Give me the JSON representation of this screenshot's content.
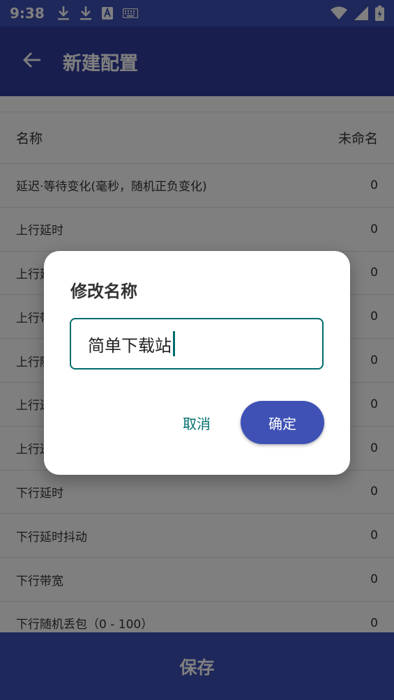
{
  "status_bar": {
    "time": "9:38",
    "left_icons": [
      "download-icon",
      "download-icon",
      "text-a-icon",
      "keyboard-icon"
    ],
    "right_icons": [
      "wifi-icon",
      "signal-icon",
      "battery-icon"
    ]
  },
  "app_bar": {
    "title": "新建配置",
    "back_icon": "arrow-back-icon"
  },
  "list": {
    "rows": [
      {
        "label": "名称",
        "value": "未命名"
      },
      {
        "label": "延迟·等待变化(毫秒，随机正负变化)",
        "value": "0"
      },
      {
        "label": "上行延时",
        "value": "0"
      },
      {
        "label": "上行延",
        "value": "0"
      },
      {
        "label": "上行带",
        "value": "0"
      },
      {
        "label": "上行随",
        "value": "0"
      },
      {
        "label": "上行送",
        "value": "0"
      },
      {
        "label": "上行送",
        "value": "0"
      },
      {
        "label": "下行延时",
        "value": "0"
      },
      {
        "label": "下行延时抖动",
        "value": "0"
      },
      {
        "label": "下行带宽",
        "value": "0"
      },
      {
        "label": "下行随机丢包（0 - 100）",
        "value": "0"
      }
    ]
  },
  "save_label": "保存",
  "dialog": {
    "title": "修改名称",
    "input_value": "简单下载站",
    "cancel_label": "取消",
    "confirm_label": "确定"
  },
  "colors": {
    "primary": "#3f51b5",
    "primary_dark": "#303f9f",
    "accent_teal": "#006b6b",
    "divider": "#e0e0e0"
  }
}
